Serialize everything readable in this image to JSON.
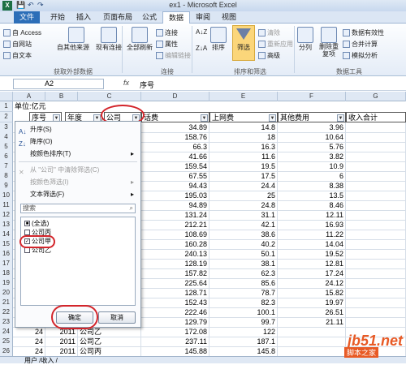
{
  "window": {
    "title": "ex1 - Microsoft Excel",
    "app_icon": "X"
  },
  "qat": {
    "save": "💾",
    "undo": "↶",
    "redo": "↷"
  },
  "tabs": [
    "文件",
    "开始",
    "插入",
    "页面布局",
    "公式",
    "数据",
    "审阅",
    "视图"
  ],
  "active_tab": "数据",
  "ribbon": {
    "get_external": {
      "access": "自 Access",
      "web": "自网站",
      "text": "自文本",
      "other": "自其他来源",
      "existing": "现有连接",
      "label": "获取外部数据"
    },
    "connections": {
      "refresh": "全部刷新",
      "conn": "连接",
      "props": "属性",
      "edit_links": "编辑链接",
      "label": "连接"
    },
    "sort_filter": {
      "sort_az": "A↓Z",
      "sort_za": "Z↓A",
      "sort": "排序",
      "filter": "筛选",
      "clear": "清除",
      "reapply": "重新应用",
      "advanced": "高级",
      "label": "排序和筛选"
    },
    "data_tools": {
      "split": "分列",
      "remove_dup": "删除重复项",
      "validation": "数据有效性",
      "consolidate": "合并计算",
      "whatif": "模拟分析",
      "label": "数据工具"
    }
  },
  "formula_bar": {
    "name_box": "A2",
    "fx": "fx",
    "value": "序号"
  },
  "columns": [
    "A",
    "B",
    "C",
    "D",
    "E",
    "F",
    "G"
  ],
  "row1_title": "单位:亿元",
  "headers": [
    "序号",
    "年度",
    "公司",
    "话费",
    "上网费",
    "其他费用",
    "收入合计"
  ],
  "rows": [
    {
      "r": "3",
      "d": "34.89",
      "e": "14.8",
      "f": "3.96"
    },
    {
      "r": "4",
      "d": "158.76",
      "e": "18",
      "f": "10.64"
    },
    {
      "r": "5",
      "d": "66.3",
      "e": "16.3",
      "f": "5.76"
    },
    {
      "r": "6",
      "d": "41.66",
      "e": "11.6",
      "f": "3.82"
    },
    {
      "r": "7",
      "d": "159.54",
      "e": "19.5",
      "f": "10.9"
    },
    {
      "r": "8",
      "d": "67.55",
      "e": "17.5",
      "f": "6"
    },
    {
      "r": "9",
      "d": "94.43",
      "e": "24.4",
      "f": "8.38"
    },
    {
      "r": "10",
      "d": "195.03",
      "e": "25",
      "f": "13.5"
    },
    {
      "r": "11",
      "d": "94.89",
      "e": "24.8",
      "f": "8.46"
    },
    {
      "r": "12",
      "d": "131.24",
      "e": "31.1",
      "f": "12.11"
    },
    {
      "r": "13",
      "d": "212.21",
      "e": "42.1",
      "f": "16.93"
    },
    {
      "r": "14",
      "d": "108.69",
      "e": "38.6",
      "f": "11.22"
    },
    {
      "r": "15",
      "d": "160.28",
      "e": "40.2",
      "f": "14.04"
    },
    {
      "r": "16",
      "d": "240.13",
      "e": "50.1",
      "f": "19.52"
    },
    {
      "r": "17",
      "d": "128.19",
      "e": "38.1",
      "f": "12.81"
    },
    {
      "r": "18",
      "d": "157.82",
      "e": "62.3",
      "f": "17.24"
    },
    {
      "r": "19",
      "d": "225.64",
      "e": "85.6",
      "f": "24.12"
    },
    {
      "r": "20",
      "d": "128.71",
      "e": "78.7",
      "f": "15.82"
    },
    {
      "r": "21",
      "d": "152.43",
      "e": "82.3",
      "f": "19.97"
    },
    {
      "r": "22",
      "d": "222.46",
      "e": "100.1",
      "f": "26.51"
    },
    {
      "r": "23",
      "d": "129.79",
      "e": "99.7",
      "f": "21.11"
    },
    {
      "r": "24",
      "a": "24",
      "b": "2011",
      "c": "公司乙",
      "d": "172.08",
      "e": "122",
      "f": ""
    },
    {
      "r": "25",
      "a": "24",
      "b": "2011",
      "c": "公司乙",
      "d": "237.11",
      "e": "187.1",
      "f": ""
    },
    {
      "r": "26",
      "a": "24",
      "b": "2011",
      "c": "公司丙",
      "d": "145.88",
      "e": "145.8",
      "f": ""
    }
  ],
  "filter_menu": {
    "sort_asc": "升序(S)",
    "sort_desc": "降序(O)",
    "sort_color": "按颜色排序(T)",
    "clear": "从 \"公司\" 中清除筛选(C)",
    "color_filter": "按颜色筛选(I)",
    "text_filter": "文本筛选(F)",
    "search_placeholder": "搜索",
    "items": [
      {
        "label": "(全选)",
        "state": "■"
      },
      {
        "label": "公司丙",
        "state": ""
      },
      {
        "label": "公司甲",
        "state": "✓"
      },
      {
        "label": "公司乙",
        "state": ""
      }
    ],
    "ok": "确定",
    "cancel": "取消"
  },
  "sheet_tabs": "用户 /收入 /",
  "watermark": {
    "text": "jb51.net",
    "sub": "脚本之家"
  }
}
